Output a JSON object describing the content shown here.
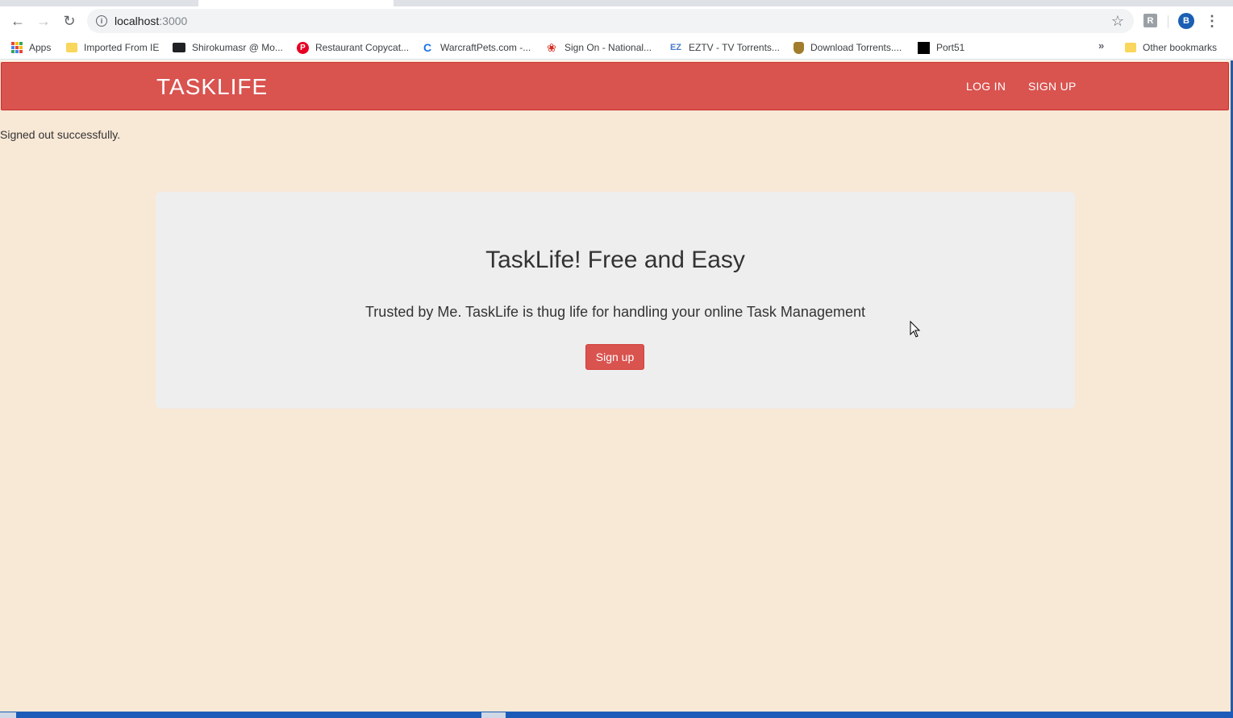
{
  "browser": {
    "url_host": "localhost",
    "url_port": ":3000",
    "profile_initial": "B",
    "extension_label": "R",
    "bookmarks": [
      {
        "label": "Apps",
        "icon": "apps-icon"
      },
      {
        "label": "Imported From IE",
        "icon": "folder-icon"
      },
      {
        "label": "Shirokumasr @ Mo...",
        "icon": "film-icon"
      },
      {
        "label": "Restaurant Copycat...",
        "icon": "pinterest-icon"
      },
      {
        "label": "WarcraftPets.com -...",
        "icon": "warcraftpets-icon"
      },
      {
        "label": "Sign On - National...",
        "icon": "maple-leaf-icon"
      },
      {
        "label": "EZTV - TV Torrents...",
        "icon": "eztv-icon"
      },
      {
        "label": "Download Torrents....",
        "icon": "shield-icon"
      },
      {
        "label": "Port51",
        "icon": "port51-icon"
      }
    ],
    "other_bookmarks": "Other bookmarks"
  },
  "navbar": {
    "brand": "TASKLIFE",
    "login": "LOG IN",
    "signup": "SIGN UP"
  },
  "flash": "Signed out successfully.",
  "jumbotron": {
    "title": "TaskLife! Free and Easy",
    "text": "Trusted by Me. TaskLife is thug life for handling your online Task Management",
    "button": "Sign up"
  },
  "colors": {
    "navbar": "#d9534f",
    "page_background": "#f8e8d6",
    "jumbotron": "#eeeeee"
  }
}
